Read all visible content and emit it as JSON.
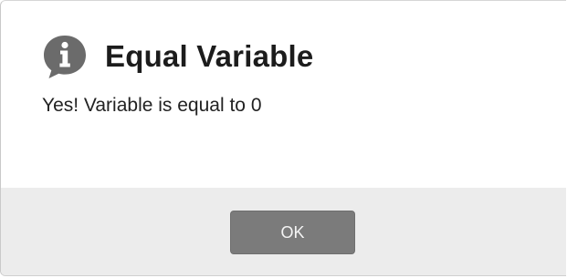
{
  "dialog": {
    "icon": "info-icon",
    "title": "Equal Variable",
    "message": "Yes! Variable is equal to 0",
    "ok_label": "OK"
  },
  "colors": {
    "icon": "#6b6b6b",
    "footer_background": "#ececec",
    "button_background": "#7b7b7b",
    "button_text": "#f4f4f4"
  }
}
